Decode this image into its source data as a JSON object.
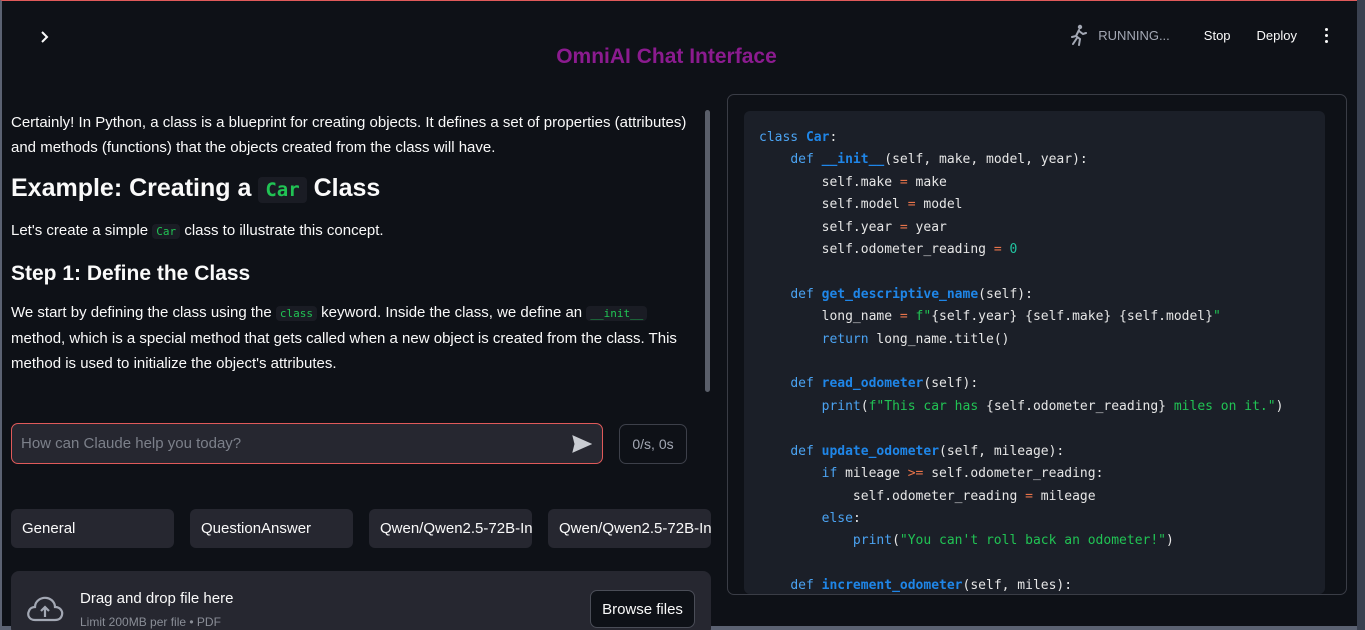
{
  "header": {
    "status": "RUNNING...",
    "stop_label": "Stop",
    "deploy_label": "Deploy",
    "app_title": "OmniAI Chat Interface"
  },
  "message": {
    "intro": "Certainly! In Python, a class is a blueprint for creating objects. It defines a set of properties (attributes) and methods (functions) that the objects created from the class will have.",
    "h2_prefix": "Example: Creating a",
    "h2_code": "Car",
    "h2_suffix": "Class",
    "p2_prefix": "Let's create a simple",
    "p2_code": "Car",
    "p2_suffix": "class to illustrate this concept.",
    "h3": "Step 1: Define the Class",
    "p3_a": "We start by defining the class using the",
    "p3_code1": "class",
    "p3_b": "keyword. Inside the class, we define an",
    "p3_code2": "__init__",
    "p3_c": "method, which is a special method that gets called when a new object is created from the class. This method is used to initialize the object's attributes."
  },
  "input": {
    "placeholder": "How can Claude help you today?",
    "rate": "0/s, 0s"
  },
  "selects": [
    "General",
    "QuestionAnswer",
    "Qwen/Qwen2.5-72B-In",
    "Qwen/Qwen2.5-72B-In"
  ],
  "uploader": {
    "title": "Drag and drop file here",
    "subtitle": "Limit 200MB per file • PDF",
    "browse_label": "Browse files"
  },
  "icons": {
    "sidebar": "chevron-right-icon",
    "running": "running-man-icon",
    "menu": "kebab-menu-icon",
    "send": "send-icon",
    "upload": "cloud-upload-icon"
  },
  "colors": {
    "accent": "#e05a5a",
    "title": "#8b1b8f",
    "code_green": "#21c354"
  }
}
